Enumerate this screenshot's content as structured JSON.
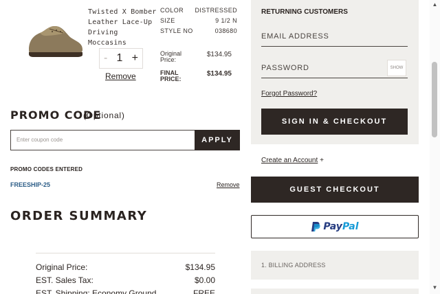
{
  "product": {
    "name_lines": [
      "Twisted X Bomber",
      "Leather Lace-Up",
      "Driving Moccasins"
    ],
    "specs": [
      {
        "label": "COLOR",
        "value": "DISTRESSED"
      },
      {
        "label": "SIZE",
        "value": "9 1/2 N"
      },
      {
        "label": "STYLE NO",
        "value": "038680"
      }
    ],
    "quantity": {
      "minus": "-",
      "value": "1",
      "plus": "+"
    },
    "remove_label": "Remove",
    "original_price_label": "Original Price:",
    "original_price": "$134.95",
    "final_price_label": "FINAL PRICE:",
    "final_price": "$134.95",
    "image_icon": "shoe-image"
  },
  "promo": {
    "title": "PROMO CODE",
    "optional": "(Optional)",
    "placeholder": "Enter coupon code",
    "apply_label": "APPLY",
    "entered_title": "PROMO CODES ENTERED",
    "codes": [
      {
        "code": "FREESHIP-25",
        "remove_label": "Remove"
      }
    ]
  },
  "order_summary": {
    "title": "ORDER SUMMARY",
    "rows": [
      {
        "label": "Original Price:",
        "value": "$134.95"
      },
      {
        "label": "EST. Sales Tax:",
        "value": "$0.00"
      },
      {
        "label": "EST. Shipping: Economy Ground",
        "value": "FREE"
      }
    ]
  },
  "returning": {
    "title": "RETURNING CUSTOMERS",
    "email_placeholder": "EMAIL ADDRESS",
    "password_placeholder": "PASSWORD",
    "show_label": "SHOW",
    "forgot_label": "Forgot Password?",
    "signin_label": "SIGN IN & CHECKOUT"
  },
  "account": {
    "create_label": "Create an Account",
    "create_icon": "+",
    "guest_label": "GUEST CHECKOUT",
    "paypal_pay": "Pay",
    "paypal_pal": "Pal"
  },
  "steps": {
    "billing": "1. BILLING ADDRESS"
  },
  "colors": {
    "dark_button": "#2e2724",
    "panel_bg": "#f0efec",
    "promo_code_blue": "#2c5d87",
    "paypal_dark": "#253b80",
    "paypal_light": "#179bd7"
  }
}
